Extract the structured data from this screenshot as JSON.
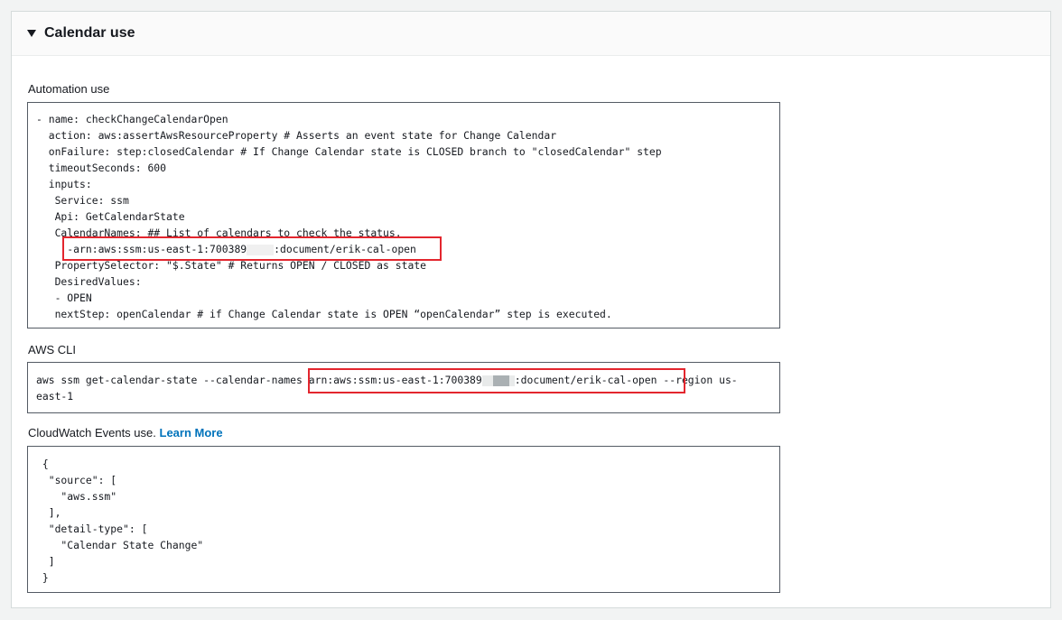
{
  "panel": {
    "title": "Calendar use"
  },
  "automation": {
    "label": "Automation use",
    "lines": [
      "- name: checkChangeCalendarOpen",
      "  action: aws:assertAwsResourceProperty # Asserts an event state for Change Calendar",
      "  onFailure: step:closedCalendar # If Change Calendar state is CLOSED branch to \"closedCalendar\" step",
      "  timeoutSeconds: 600",
      "  inputs:",
      "   Service: ssm",
      "   Api: GetCalendarState",
      "   CalendarNames: ## List of calendars to check the status.",
      "     -arn:aws:ssm:us-east-1:700389",
      "   PropertySelector: \"$.State\" # Returns OPEN / CLOSED as state",
      "   DesiredValues:",
      "   - OPEN",
      "   nextStep: openCalendar # if Change Calendar state is OPEN “openCalendar” step is executed."
    ],
    "arn_suffix": ":document/erik-cal-open"
  },
  "cli": {
    "label": "AWS CLI",
    "prefix": "aws ssm get-calendar-state --calendar-names ",
    "arn_prefix": "arn:aws:ssm:us-east-1:700389",
    "arn_suffix": ":document/erik-cal-open",
    "after": " --region us-",
    "line2": "east-1"
  },
  "cloudwatch": {
    "label": "CloudWatch Events use.",
    "link": "Learn More",
    "lines": [
      " {",
      "  \"source\": [",
      "    \"aws.ssm\"",
      "  ],",
      "  \"detail-type\": [",
      "    \"Calendar State Change\"",
      "  ]",
      " }"
    ]
  },
  "colors": {
    "highlight": "#e3262e",
    "link": "#0073bb"
  }
}
